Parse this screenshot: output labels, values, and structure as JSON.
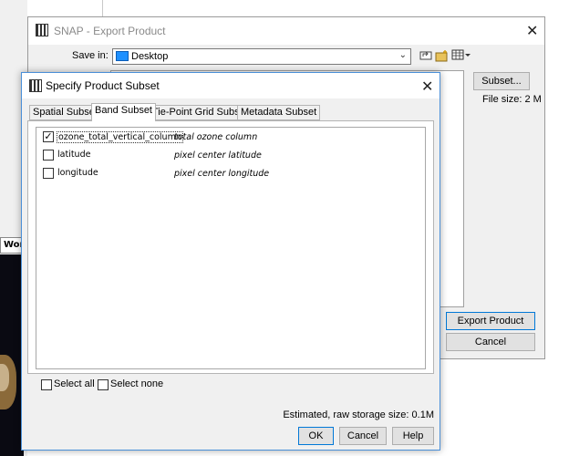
{
  "background": {
    "partial_window_label": "Wor"
  },
  "export_window": {
    "title": "SNAP - Export Product",
    "close_glyph": "✕",
    "save_in_label": "Save in:",
    "save_in_value": "Desktop",
    "subset_button": "Subset...",
    "file_size": "File size: 2 M",
    "export_button": "Export Product",
    "cancel_button": "Cancel",
    "toolbar_icons": [
      "up-folder-icon",
      "new-folder-icon",
      "view-menu-icon"
    ]
  },
  "dialog": {
    "title": "Specify Product Subset",
    "close_glyph": "✕",
    "tabs": [
      {
        "label": "Spatial Subset",
        "active": false
      },
      {
        "label": "Band Subset",
        "active": true
      },
      {
        "label": "Tie-Point Grid Subset",
        "active": false
      },
      {
        "label": "Metadata Subset",
        "active": false
      }
    ],
    "bands": [
      {
        "name": "ozone_total_vertical_column",
        "description": "total ozone column",
        "checked": true
      },
      {
        "name": "latitude",
        "description": "pixel center latitude",
        "checked": false
      },
      {
        "name": "longitude",
        "description": "pixel center longitude",
        "checked": false
      }
    ],
    "select_all": "Select all",
    "select_none": "Select none",
    "storage_size": "Estimated, raw storage size: 0.1M",
    "ok_button": "OK",
    "cancel_button": "Cancel",
    "help_button": "Help"
  },
  "colors": {
    "dialog_border": "#4a8fd8",
    "focus_border": "#0078d7",
    "window_bg": "#f0f0f0"
  }
}
